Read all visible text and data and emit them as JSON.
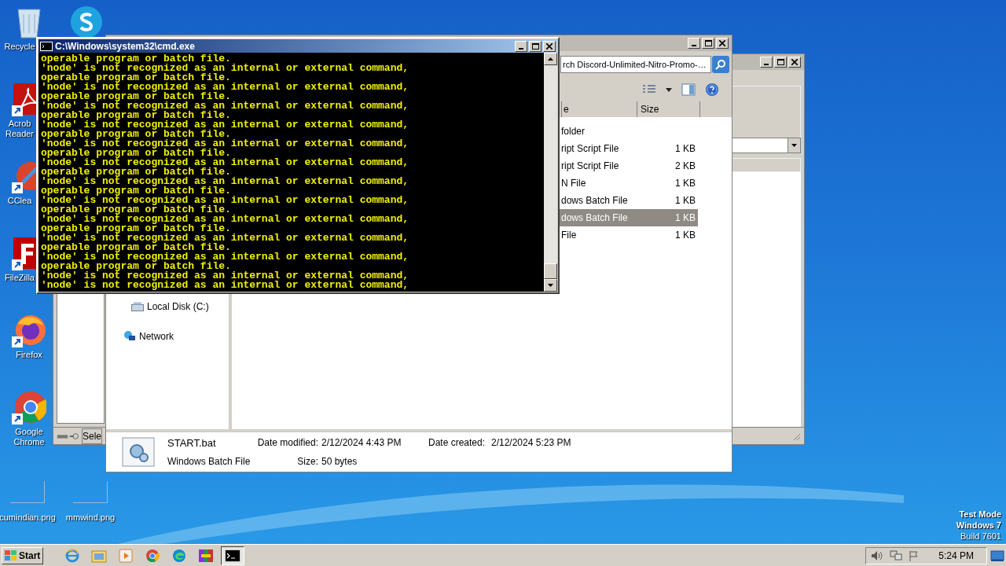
{
  "desktop_icons": [
    {
      "kind": "recycle",
      "lines": [
        "Recycle"
      ]
    },
    {
      "kind": "acrobat",
      "lines": [
        "Acrob",
        "Reader"
      ]
    },
    {
      "kind": "ccleaner",
      "lines": [
        "CClea"
      ]
    },
    {
      "kind": "filezilla",
      "lines": [
        "FileZilla"
      ]
    },
    {
      "kind": "firefox",
      "lines": [
        "Firefox"
      ]
    },
    {
      "kind": "chrome",
      "lines": [
        "Google",
        "Chrome"
      ]
    }
  ],
  "skype_icon": {
    "kind": "skype"
  },
  "desktop_files": [
    {
      "label": "cumindian.png"
    },
    {
      "label": "mmwind.png"
    }
  ],
  "background_window": {
    "status_text": "Sele"
  },
  "explorer": {
    "search": "rch Discord-Unlimited-Nitro-Promo-…",
    "columns": [
      "e",
      "Size"
    ],
    "rows": [
      {
        "type": "folder",
        "selected": false
      },
      {
        "type": "ript Script File",
        "size": "1 KB",
        "selected": false
      },
      {
        "type": "ript Script File",
        "size": "2 KB",
        "selected": false
      },
      {
        "type": "N File",
        "size": "1 KB",
        "selected": false
      },
      {
        "type": "dows Batch File",
        "size": "1 KB",
        "selected": false
      },
      {
        "type": "dows Batch File",
        "size": "1 KB",
        "selected": true
      },
      {
        "type": "File",
        "size": "1 KB",
        "selected": false
      }
    ],
    "nav": [
      {
        "kind": "disk",
        "label": "Local Disk (C:)"
      },
      {
        "kind": "network",
        "label": "Network"
      }
    ],
    "details": [
      {
        "title": "START.bat",
        "fields": [
          {
            "label": "Date modified:",
            "value": "2/12/2024 4:43 PM"
          },
          {
            "label": "Date created:",
            "value": "2/12/2024 5:23 PM"
          }
        ]
      },
      {
        "title": "Windows Batch File",
        "fields": [
          {
            "label": "Size:",
            "value": "50 bytes"
          }
        ]
      }
    ]
  },
  "cmd": {
    "title": "C:\\Windows\\system32\\cmd.exe",
    "lines": [
      "operable program or batch file.",
      "'node' is not recognized as an internal or external command,",
      "operable program or batch file.",
      "'node' is not recognized as an internal or external command,",
      "operable program or batch file.",
      "'node' is not recognized as an internal or external command,",
      "operable program or batch file.",
      "'node' is not recognized as an internal or external command,",
      "operable program or batch file.",
      "'node' is not recognized as an internal or external command,",
      "operable program or batch file.",
      "'node' is not recognized as an internal or external command,",
      "operable program or batch file.",
      "'node' is not recognized as an internal or external command,",
      "operable program or batch file.",
      "'node' is not recognized as an internal or external command,",
      "operable program or batch file.",
      "'node' is not recognized as an internal or external command,",
      "operable program or batch file.",
      "'node' is not recognized as an internal or external command,",
      "operable program or batch file.",
      "'node' is not recognized as an internal or external command,",
      "operable program or batch file.",
      "'node' is not recognized as an internal or external command,",
      "'node' is not recognized as an internal or external command,"
    ]
  },
  "os_info": [
    "Test Mode",
    "Windows 7",
    "Build 7601"
  ],
  "taskbar": {
    "start": "Start",
    "apps": [
      {
        "kind": "ie",
        "selected": false
      },
      {
        "kind": "explorer",
        "selected": false
      },
      {
        "kind": "media",
        "selected": false
      },
      {
        "kind": "chrome",
        "selected": false
      },
      {
        "kind": "edge",
        "selected": false
      },
      {
        "kind": "winrar",
        "selected": false
      },
      {
        "kind": "cmd",
        "selected": true
      }
    ],
    "clock": "5:24 PM"
  }
}
